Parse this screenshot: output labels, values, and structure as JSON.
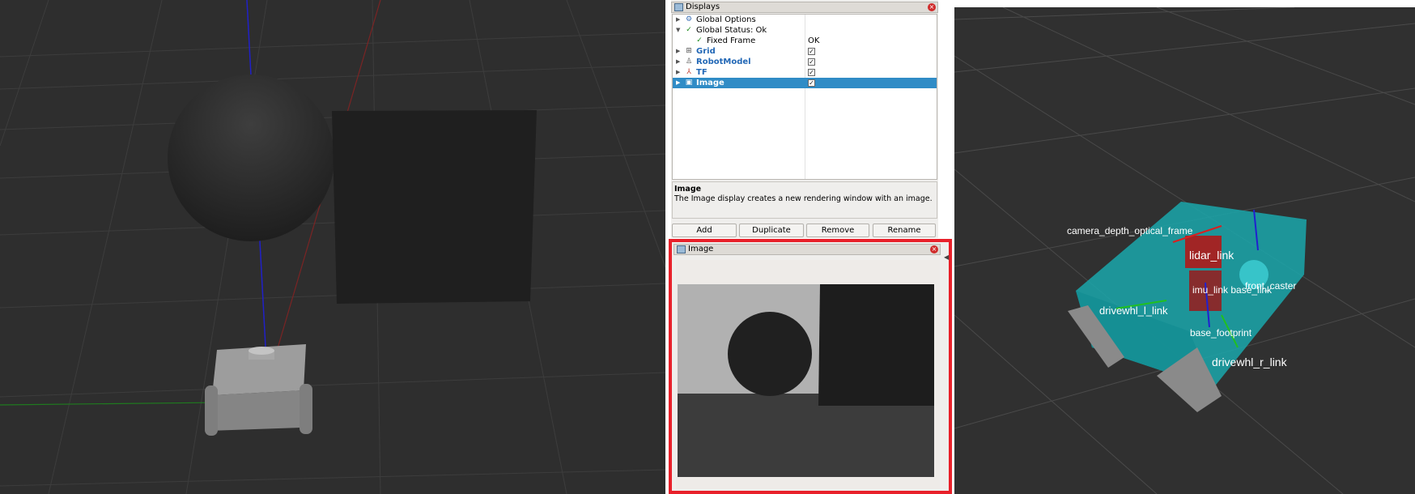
{
  "displays_panel": {
    "title": "Displays",
    "items": [
      {
        "label": "Global Options",
        "value": "",
        "checked": null,
        "style": "normal"
      },
      {
        "label": "Global Status: Ok",
        "value": "",
        "checked": null,
        "style": "normal"
      },
      {
        "label": "Fixed Frame",
        "value": "OK",
        "checked": null,
        "style": "child"
      },
      {
        "label": "Grid",
        "value": "",
        "checked": true,
        "style": "blue"
      },
      {
        "label": "RobotModel",
        "value": "",
        "checked": true,
        "style": "blue"
      },
      {
        "label": "TF",
        "value": "",
        "checked": true,
        "style": "blue"
      },
      {
        "label": "Image",
        "value": "",
        "checked": true,
        "style": "selected"
      }
    ],
    "description_title": "Image",
    "description_text": "The Image display creates a new rendering window with an image.",
    "buttons": {
      "add": "Add",
      "duplicate": "Duplicate",
      "remove": "Remove",
      "rename": "Rename"
    }
  },
  "image_panel": {
    "title": "Image"
  },
  "rviz_view": {
    "tf_labels": {
      "camera_frames": "camera_depth_optical_frame",
      "lidar": "lidar_link",
      "imu_base": "imu_link base_link",
      "front_caster": "front_caster",
      "left_wheel": "drivewhl_l_link",
      "footprint": "base_footprint",
      "right_wheel": "drivewhl_r_link"
    }
  },
  "colors": {
    "highlight_red": "#e8202a",
    "selection_blue": "#308cc6",
    "robot_teal": "#19a8ad"
  }
}
